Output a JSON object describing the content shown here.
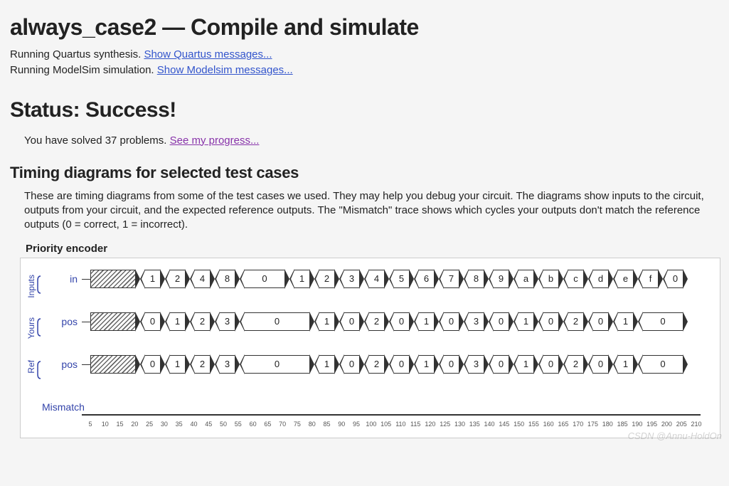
{
  "title": "always_case2 — Compile and simulate",
  "run_lines": [
    {
      "prefix": "Running Quartus synthesis. ",
      "link": "Show Quartus messages..."
    },
    {
      "prefix": "Running ModelSim simulation. ",
      "link": "Show Modelsim messages..."
    }
  ],
  "status_heading": "Status: Success!",
  "progress": {
    "prefix": "You have solved 37 problems. ",
    "link": "See my progress..."
  },
  "td_heading": "Timing diagrams for selected test cases",
  "td_desc": "These are timing diagrams from some of the test cases we used. They may help you debug your circuit. The diagrams show inputs to the circuit, outputs from your circuit, and the expected reference outputs. The \"Mismatch\" trace shows which cycles your outputs don't match the reference outputs (0 = correct, 1 = incorrect).",
  "diagram": {
    "title": "Priority encoder",
    "time_axis": {
      "start": 5,
      "end": 210,
      "step": 5
    },
    "groups": [
      {
        "id": "inputs",
        "label": "Inputs",
        "signals": [
          {
            "name": "in",
            "values": [
              "hatch",
              "1",
              "2",
              "4",
              "8",
              "0",
              "1",
              "2",
              "3",
              "4",
              "5",
              "6",
              "7",
              "8",
              "9",
              "a",
              "b",
              "c",
              "d",
              "e",
              "f",
              "0"
            ],
            "widths": [
              2,
              1,
              1,
              1,
              1,
              2,
              1,
              1,
              1,
              1,
              1,
              1,
              1,
              1,
              1,
              1,
              1,
              1,
              1,
              1,
              1,
              1
            ]
          }
        ]
      },
      {
        "id": "yours",
        "label": "Yours",
        "signals": [
          {
            "name": "pos",
            "values": [
              "hatch",
              "0",
              "1",
              "2",
              "3",
              "0",
              "1",
              "0",
              "2",
              "0",
              "1",
              "0",
              "3",
              "0",
              "1",
              "0",
              "2",
              "0",
              "1",
              "0"
            ],
            "widths": [
              2,
              1,
              1,
              1,
              1,
              3,
              1,
              1,
              1,
              1,
              1,
              1,
              1,
              1,
              1,
              1,
              1,
              1,
              1,
              2
            ]
          }
        ]
      },
      {
        "id": "ref",
        "label": "Ref",
        "signals": [
          {
            "name": "pos",
            "values": [
              "hatch",
              "0",
              "1",
              "2",
              "3",
              "0",
              "1",
              "0",
              "2",
              "0",
              "1",
              "0",
              "3",
              "0",
              "1",
              "0",
              "2",
              "0",
              "1",
              "0"
            ],
            "widths": [
              2,
              1,
              1,
              1,
              1,
              3,
              1,
              1,
              1,
              1,
              1,
              1,
              1,
              1,
              1,
              1,
              1,
              1,
              1,
              2
            ]
          }
        ]
      }
    ],
    "mismatch_label": "Mismatch"
  },
  "watermark": "CSDN @Annu-HoldOn"
}
